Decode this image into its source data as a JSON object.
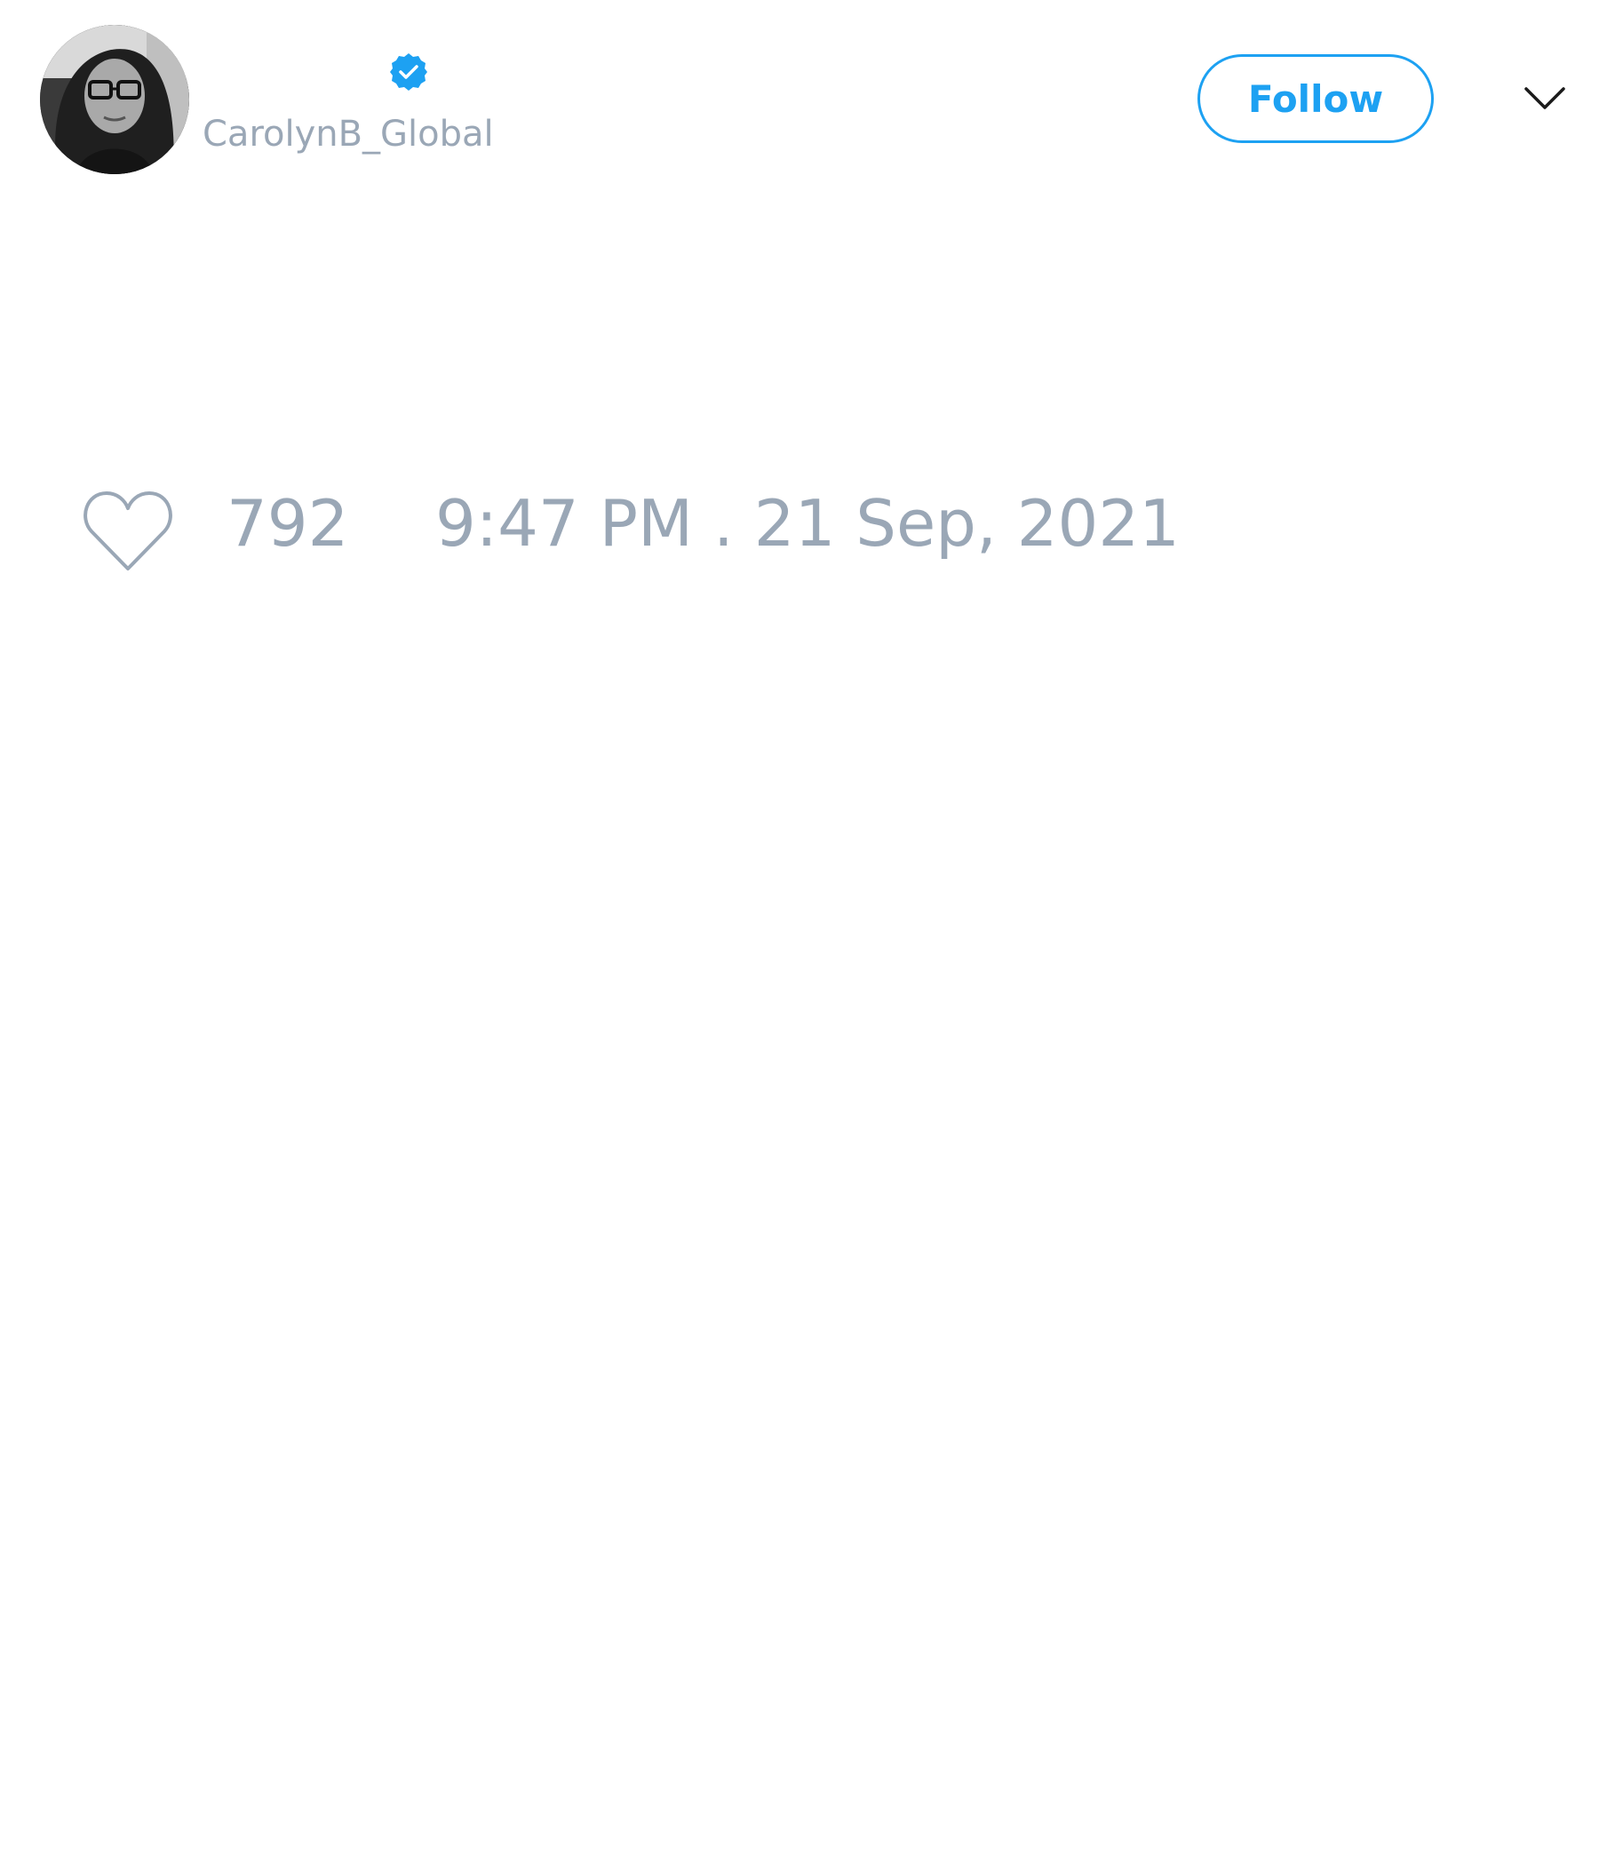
{
  "author": {
    "handle": "CarolynB_Global",
    "verified": true,
    "avatar_icon": "profile-photo-avatar"
  },
  "header": {
    "follow_label": "Follow",
    "menu_icon": "chevron-down-icon"
  },
  "engagement": {
    "like_icon": "heart-icon",
    "like_count": "792"
  },
  "tweet": {
    "timestamp": "9:47 PM . 21 Sep, 2021"
  },
  "colors": {
    "accent": "#1da1f2",
    "muted_text": "#9aa7b6",
    "icon_dark": "#1a1a1a",
    "background": "#ffffff"
  }
}
